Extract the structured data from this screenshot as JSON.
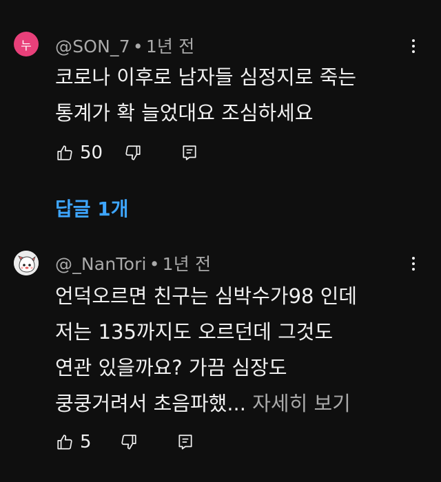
{
  "comments": [
    {
      "avatar_letter": "누",
      "avatar_color": "#e8407a",
      "author": "@SON_7",
      "time": "1년 전",
      "lines": [
        "코로나 이후로 남자들 심정지로 죽는",
        "통계가 확 늘었대요 조심하세요"
      ],
      "likes": "50",
      "replies_label": "답글 1개"
    },
    {
      "author": "@_NanTori",
      "time": "1년 전",
      "lines": [
        "언덕오르면 친구는 심박수가98 인데",
        "저는 135까지도 오르던데 그것도",
        "연관 있을까요? 가끔 심장도",
        "쿵쿵거려서 초음파했..."
      ],
      "more_label": "자세히 보기",
      "likes": "5"
    }
  ],
  "icons": {
    "like": "thumbs-up-icon",
    "dislike": "thumbs-down-icon",
    "reply": "reply-icon",
    "menu": "more-vert-icon"
  },
  "colors": {
    "background": "#0f0f0f",
    "link": "#3ea6ff",
    "secondary": "#aaaaaa"
  }
}
